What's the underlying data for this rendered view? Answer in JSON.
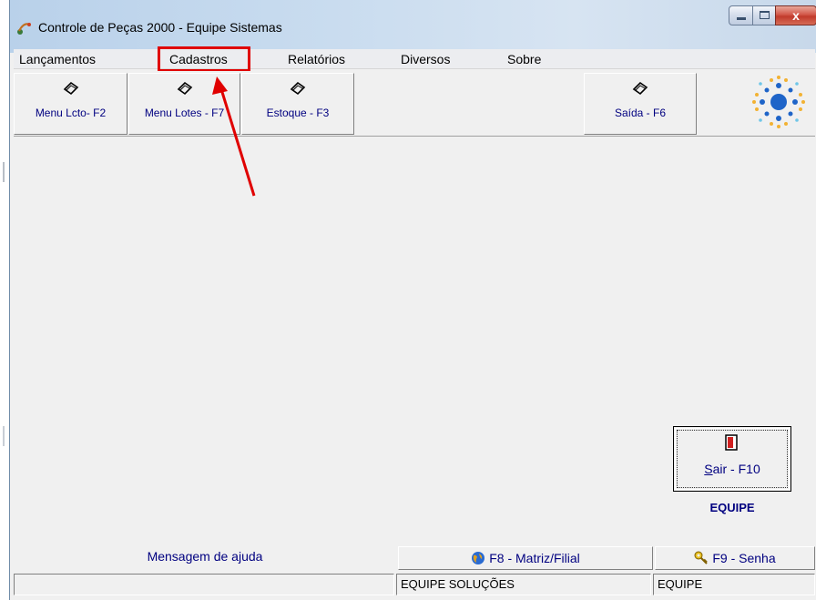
{
  "window": {
    "title": "Controle de Peças 2000 - Equipe Sistemas",
    "close_glyph": "x"
  },
  "menu": {
    "items": [
      {
        "label": "Lançamentos"
      },
      {
        "label": "Cadastros"
      },
      {
        "label": "Relatórios"
      },
      {
        "label": "Diversos"
      },
      {
        "label": "Sobre"
      }
    ],
    "highlighted_item": "Cadastros"
  },
  "toolbar": {
    "buttons": [
      {
        "label": "Menu Lcto- F2",
        "icon": "open-book-icon"
      },
      {
        "label": "Menu Lotes - F7",
        "icon": "open-book-icon"
      },
      {
        "label": "Estoque - F3",
        "icon": "open-book-icon"
      },
      {
        "label": "Saída - F6",
        "icon": "open-book-icon"
      }
    ]
  },
  "main": {
    "exit_button": {
      "shortcut_letter": "S",
      "rest_label": "air - F10",
      "icon": "door-exit-icon"
    },
    "brand_label": "EQUIPE"
  },
  "status": {
    "help_message": "Mensagem de ajuda",
    "filial_button": "F8 - Matriz/Filial",
    "senha_button": "F9 - Senha",
    "panels": [
      "",
      "EQUIPE SOLUÇÕES",
      "EQUIPE"
    ]
  },
  "colors": {
    "accent_text": "#000080",
    "highlight": "#e00000",
    "logo_primary": "#1e64c8",
    "logo_secondary": "#f2b233"
  }
}
